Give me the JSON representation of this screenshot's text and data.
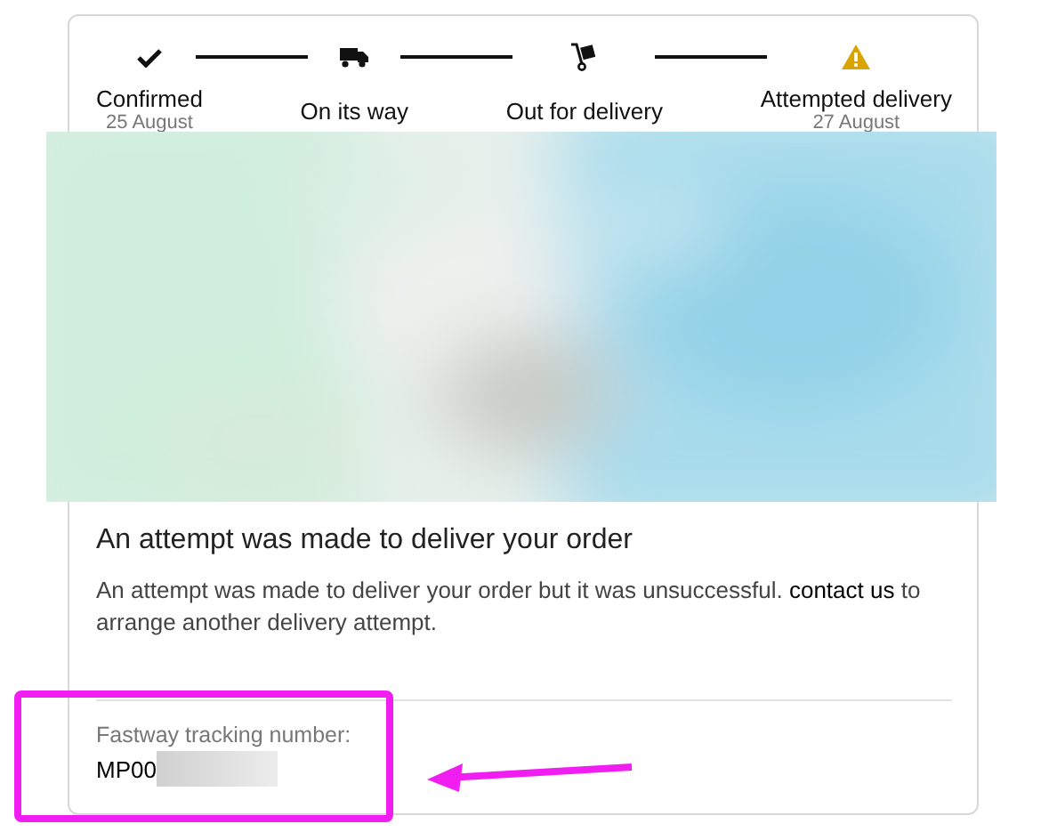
{
  "steps": [
    {
      "kind": "check",
      "label": "Confirmed",
      "date": "25 August"
    },
    {
      "kind": "truck",
      "label": "On its way"
    },
    {
      "kind": "trolley",
      "label": "Out for delivery"
    },
    {
      "kind": "warning",
      "label": "Attempted delivery",
      "date": "27 August"
    }
  ],
  "message": {
    "heading": "An attempt was made to deliver your order",
    "text_before": "An attempt was made to deliver your order but it was unsuccessful.",
    "link": "contact us",
    "text_after": "to arrange another delivery attempt."
  },
  "tracking": {
    "label": "Fastway tracking number:",
    "value": "MP00",
    "redacted": true
  },
  "annotation": {
    "highlight": true
  }
}
